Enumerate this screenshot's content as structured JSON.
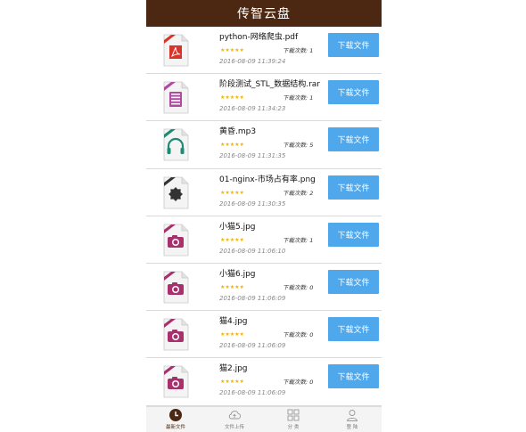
{
  "app": {
    "title": "传智云盘"
  },
  "files": [
    {
      "name": "python-网络爬虫.pdf",
      "downloads_label": "下载次数: 1",
      "date": "2016-08-09 11:39:24",
      "button": "下载文件",
      "type": "pdf",
      "rating": 5,
      "stars": "★★★★★",
      "color": "#d9342b",
      "icon": "pdf-file-icon"
    },
    {
      "name": "阶段测试_STL_数据结构.rar",
      "downloads_label": "下载次数: 1",
      "date": "2016-08-09 11:34:23",
      "button": "下载文件",
      "type": "rar",
      "rating": 5,
      "stars": "★★★★★",
      "color": "#b14aa3",
      "icon": "archive-file-icon"
    },
    {
      "name": "黄昏.mp3",
      "downloads_label": "下载次数: 5",
      "date": "2016-08-09 11:31:35",
      "button": "下载文件",
      "type": "mp3",
      "rating": 5,
      "stars": "★★★★★",
      "color": "#1f8a76",
      "icon": "audio-file-icon"
    },
    {
      "name": "01-nginx-市场占有率.png",
      "downloads_label": "下载次数: 2",
      "date": "2016-08-09 11:30:35",
      "button": "下载文件",
      "type": "png",
      "rating": 5,
      "stars": "★★★★★",
      "color": "#333333",
      "icon": "image-gear-file-icon"
    },
    {
      "name": "小猫5.jpg",
      "downloads_label": "下载次数: 1",
      "date": "2016-08-09 11:06:10",
      "button": "下载文件",
      "type": "jpg",
      "rating": 5,
      "stars": "★★★★★",
      "color": "#a8306d",
      "icon": "photo-file-icon"
    },
    {
      "name": "小猫6.jpg",
      "downloads_label": "下载次数: 0",
      "date": "2016-08-09 11:06:09",
      "button": "下载文件",
      "type": "jpg",
      "rating": 5,
      "stars": "★★★★★",
      "color": "#a8306d",
      "icon": "photo-file-icon"
    },
    {
      "name": "猫4.jpg",
      "downloads_label": "下载次数: 0",
      "date": "2016-08-09 11:06:09",
      "button": "下载文件",
      "type": "jpg",
      "rating": 5,
      "stars": "★★★★★",
      "color": "#a8306d",
      "icon": "photo-file-icon"
    },
    {
      "name": "猫2.jpg",
      "downloads_label": "下载次数: 0",
      "date": "2016-08-09 11:06:09",
      "button": "下载文件",
      "type": "jpg",
      "rating": 5,
      "stars": "★★★★★",
      "color": "#a8306d",
      "icon": "photo-file-icon"
    }
  ],
  "tabs": [
    {
      "label": "最新文件",
      "icon": "clock-icon",
      "active": true
    },
    {
      "label": "文件上传",
      "icon": "cloud-upload-icon",
      "active": false
    },
    {
      "label": "分 类",
      "icon": "grid-icon",
      "active": false
    },
    {
      "label": "登 陆",
      "icon": "user-icon",
      "active": false
    }
  ],
  "colors": {
    "titlebar": "#4c2712",
    "button": "#4fa7ec",
    "star": "#f5b400"
  }
}
